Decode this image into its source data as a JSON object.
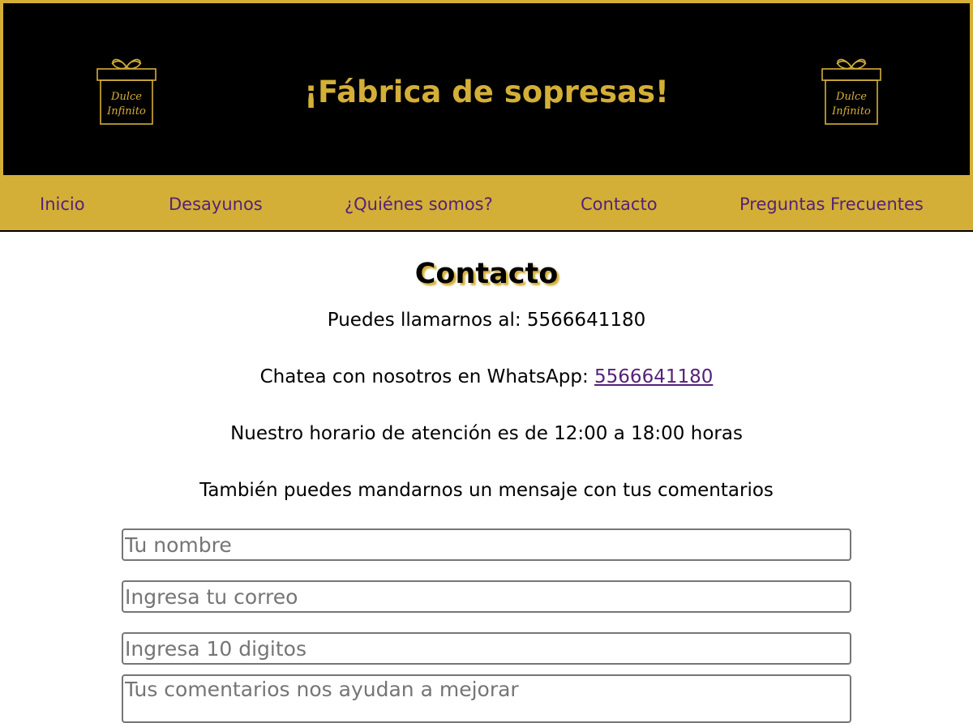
{
  "header": {
    "title": "¡Fábrica de sopresas!",
    "logo_text_line1": "Dulce",
    "logo_text_line2": "Infinito",
    "icon": "gift-box-logo-icon"
  },
  "nav": {
    "items": [
      {
        "label": "Inicio"
      },
      {
        "label": "Desayunos"
      },
      {
        "label": "¿Quiénes somos?"
      },
      {
        "label": "Contacto"
      },
      {
        "label": "Preguntas Frecuentes"
      }
    ]
  },
  "contact": {
    "title": "Contacto",
    "phone_text": "Puedes llamarnos al: 5566641180",
    "whatsapp_prefix": "Chatea con nosotros en WhatsApp: ",
    "whatsapp_number": "5566641180",
    "hours_text": "Nuestro horario de atención es de 12:00 a 18:00 horas",
    "message_intro": "También puedes mandarnos un mensaje con tus comentarios"
  },
  "form": {
    "name_placeholder": "Tu nombre",
    "email_placeholder": "Ingresa tu correo",
    "phone_placeholder": "Ingresa 10 digitos",
    "comments_placeholder": "Tus comentarios nos ayudan a mejorar"
  },
  "colors": {
    "gold": "#d4af37",
    "black": "#000000",
    "purple": "#55217a"
  }
}
